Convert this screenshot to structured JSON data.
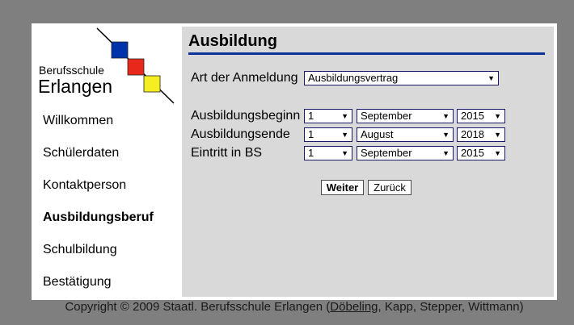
{
  "logo": {
    "line1": "Berufsschule",
    "line2": "Erlangen",
    "colors": [
      "#0033aa",
      "#e8281b",
      "#f5ee20"
    ]
  },
  "sidebar": {
    "items": [
      {
        "label": "Willkommen"
      },
      {
        "label": "Schülerdaten"
      },
      {
        "label": "Kontaktperson"
      },
      {
        "label": "Ausbildungsberuf",
        "active": true
      },
      {
        "label": "Schulbildung"
      },
      {
        "label": "Bestätigung"
      }
    ]
  },
  "main": {
    "title": "Ausbildung",
    "anmeldung": {
      "label": "Art der Anmeldung",
      "value": "Ausbildungsvertrag"
    },
    "dates": [
      {
        "label": "Ausbildungsbeginn",
        "day": "1",
        "month": "September",
        "year": "2015"
      },
      {
        "label": "Ausbildungsende",
        "day": "1",
        "month": "August",
        "year": "2018"
      },
      {
        "label": "Eintritt in BS",
        "day": "1",
        "month": "September",
        "year": "2015"
      }
    ],
    "buttons": {
      "next": "Weiter",
      "back": "Zurück"
    }
  },
  "footer": {
    "prefix": "Copyright © 2009 Staatl. Berufsschule Erlangen (",
    "link": "Döbeling",
    "suffix": ", Kapp, Stepper, Wittmann)"
  },
  "colors": {
    "accent": "#0a3399",
    "content_bg": "#d9d9d9",
    "page_bg": "#7f7f7f"
  }
}
